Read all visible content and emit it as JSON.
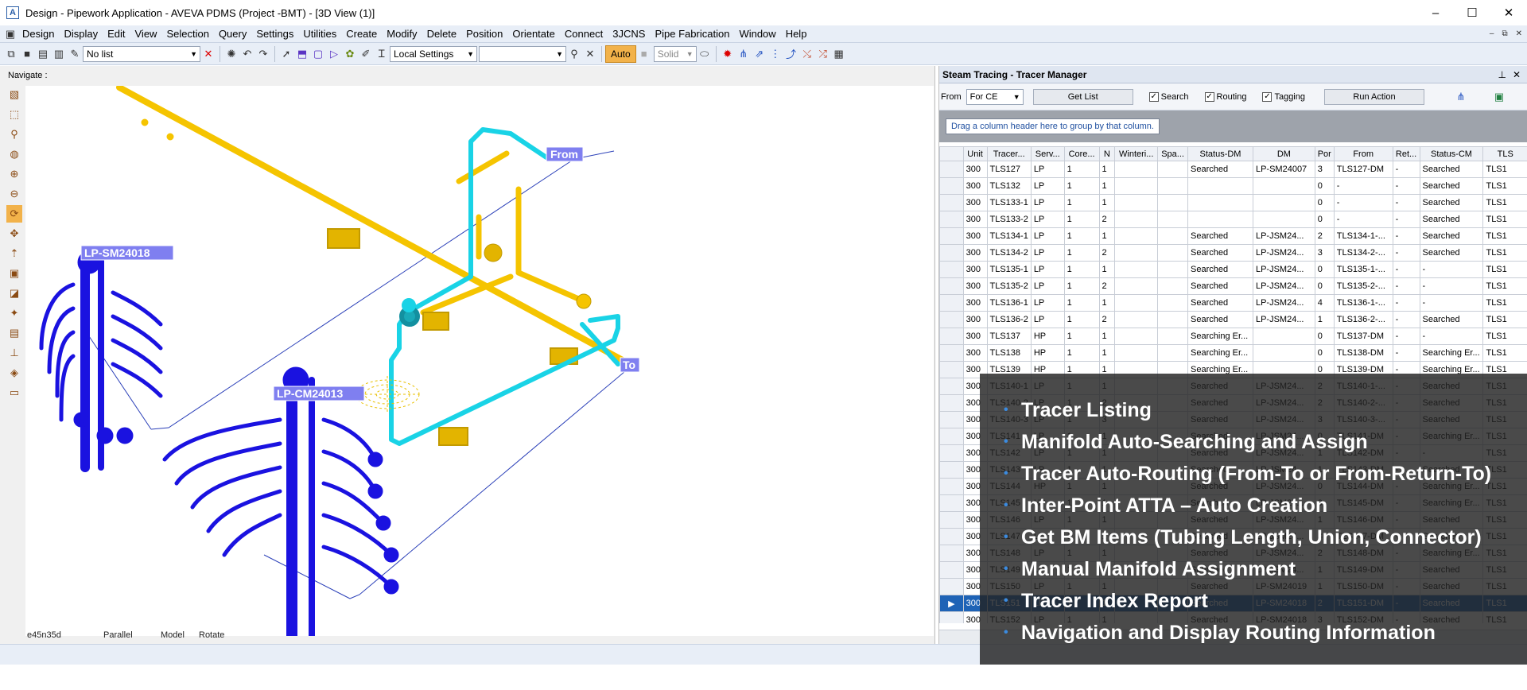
{
  "window": {
    "title": "Design - Pipework Application - AVEVA PDMS (Project -BMT) - [3D View (1)]",
    "app_icon": "A",
    "minimize": "–",
    "maximize": "☐",
    "close": "✕"
  },
  "menubar": {
    "items": [
      "Design",
      "Display",
      "Edit",
      "View",
      "Selection",
      "Query",
      "Settings",
      "Utilities",
      "Create",
      "Modify",
      "Delete",
      "Position",
      "Orientate",
      "Connect",
      "3JCNS",
      "Pipe Fabrication",
      "Window",
      "Help"
    ],
    "mdi_min": "–",
    "mdi_restore": "⧉",
    "mdi_close": "✕"
  },
  "toolbar": {
    "list_value": "No list",
    "settings_value": "Local Settings",
    "empty_combo": "",
    "auto_label": "Auto",
    "solid_label": "Solid"
  },
  "viewport": {
    "navigate_label": "Navigate :",
    "status_coord": "e45n35d",
    "status_projection": "Parallel",
    "status_mode": "Model",
    "status_action": "Rotate",
    "labels": {
      "from": "From",
      "to": "To",
      "manifold1": "LP-SM24018",
      "manifold2": "LP-CM24013"
    }
  },
  "panel": {
    "title": "Steam Tracing - Tracer Manager",
    "pin": "⊥",
    "close": "✕",
    "from_label": "From",
    "from_value": "For CE",
    "get_list": "Get List",
    "search_label": "Search",
    "routing_label": "Routing",
    "tagging_label": "Tagging",
    "run_action": "Run Action",
    "group_hint": "Drag a column header here to group by that column.",
    "columns": [
      "Unit",
      "Tracer...",
      "Serv...",
      "Core...",
      "N",
      "Winteri...",
      "Spa...",
      "Status-DM",
      "DM",
      "Por",
      "From",
      "Ret...",
      "Status-CM",
      "TLS"
    ],
    "rows": [
      [
        "300",
        "TLS127",
        "LP",
        "1",
        "1",
        "",
        "",
        "Searched",
        "LP-SM24007",
        "3",
        "TLS127-DM",
        "-",
        "Searched",
        "TLS1"
      ],
      [
        "300",
        "TLS132",
        "LP",
        "1",
        "1",
        "",
        "",
        "",
        "",
        "0",
        "-",
        "-",
        "Searched",
        "TLS1"
      ],
      [
        "300",
        "TLS133-1",
        "LP",
        "1",
        "1",
        "",
        "",
        "",
        "",
        "0",
        "-",
        "-",
        "Searched",
        "TLS1"
      ],
      [
        "300",
        "TLS133-2",
        "LP",
        "1",
        "2",
        "",
        "",
        "",
        "",
        "0",
        "-",
        "-",
        "Searched",
        "TLS1"
      ],
      [
        "300",
        "TLS134-1",
        "LP",
        "1",
        "1",
        "",
        "",
        "Searched",
        "LP-JSM24...",
        "2",
        "TLS134-1-...",
        "-",
        "Searched",
        "TLS1"
      ],
      [
        "300",
        "TLS134-2",
        "LP",
        "1",
        "2",
        "",
        "",
        "Searched",
        "LP-JSM24...",
        "3",
        "TLS134-2-...",
        "-",
        "Searched",
        "TLS1"
      ],
      [
        "300",
        "TLS135-1",
        "LP",
        "1",
        "1",
        "",
        "",
        "Searched",
        "LP-JSM24...",
        "0",
        "TLS135-1-...",
        "-",
        "-",
        "TLS1"
      ],
      [
        "300",
        "TLS135-2",
        "LP",
        "1",
        "2",
        "",
        "",
        "Searched",
        "LP-JSM24...",
        "0",
        "TLS135-2-...",
        "-",
        "-",
        "TLS1"
      ],
      [
        "300",
        "TLS136-1",
        "LP",
        "1",
        "1",
        "",
        "",
        "Searched",
        "LP-JSM24...",
        "4",
        "TLS136-1-...",
        "-",
        "-",
        "TLS1"
      ],
      [
        "300",
        "TLS136-2",
        "LP",
        "1",
        "2",
        "",
        "",
        "Searched",
        "LP-JSM24...",
        "1",
        "TLS136-2-...",
        "-",
        "Searched",
        "TLS1"
      ],
      [
        "300",
        "TLS137",
        "HP",
        "1",
        "1",
        "",
        "",
        "Searching Er...",
        "",
        "0",
        "TLS137-DM",
        "-",
        "-",
        "TLS1"
      ],
      [
        "300",
        "TLS138",
        "HP",
        "1",
        "1",
        "",
        "",
        "Searching Er...",
        "",
        "0",
        "TLS138-DM",
        "-",
        "Searching Er...",
        "TLS1"
      ],
      [
        "300",
        "TLS139",
        "HP",
        "1",
        "1",
        "",
        "",
        "Searching Er...",
        "",
        "0",
        "TLS139-DM",
        "-",
        "Searching Er...",
        "TLS1"
      ],
      [
        "300",
        "TLS140-1",
        "LP",
        "1",
        "1",
        "",
        "",
        "Searched",
        "LP-JSM24...",
        "2",
        "TLS140-1-...",
        "-",
        "Searched",
        "TLS1"
      ],
      [
        "300",
        "TLS140-2",
        "LP",
        "1",
        "2",
        "",
        "",
        "Searched",
        "LP-JSM24...",
        "2",
        "TLS140-2-...",
        "-",
        "Searched",
        "TLS1"
      ],
      [
        "300",
        "TLS140-3",
        "LP",
        "1",
        "3",
        "",
        "",
        "Searched",
        "LP-JSM24...",
        "3",
        "TLS140-3-...",
        "-",
        "Searched",
        "TLS1"
      ],
      [
        "300",
        "TLS141",
        "LP",
        "1",
        "1",
        "",
        "",
        "Searched",
        "LP-JSM24...",
        "0",
        "TLS141-DM",
        "-",
        "Searching Er...",
        "TLS1"
      ],
      [
        "300",
        "TLS142",
        "LP",
        "1",
        "1",
        "",
        "",
        "Searched",
        "LP-JSM24...",
        "1",
        "TLS142-DM",
        "-",
        "-",
        "TLS1"
      ],
      [
        "300",
        "TLS143",
        "LP",
        "1",
        "1",
        "",
        "",
        "Searched",
        "LP-JSM24...",
        "1",
        "TLS143-DM",
        "-",
        "Searched",
        "TLS1"
      ],
      [
        "300",
        "TLS144",
        "HP",
        "1",
        "1",
        "",
        "",
        "Searched",
        "LP-JSM24...",
        "0",
        "TLS144-DM",
        "-",
        "Searching Er...",
        "TLS1"
      ],
      [
        "300",
        "TLS145",
        "HP",
        "1",
        "1",
        "",
        "",
        "Searched",
        "LP-JSM24...",
        "0",
        "TLS145-DM",
        "-",
        "Searching Er...",
        "TLS1"
      ],
      [
        "300",
        "TLS146",
        "LP",
        "1",
        "1",
        "",
        "",
        "Searched",
        "LP-JSM24...",
        "1",
        "TLS146-DM",
        "-",
        "Searched",
        "TLS1"
      ],
      [
        "300",
        "TLS147",
        "LP",
        "1",
        "1",
        "",
        "",
        "Searched",
        "LP-JSM24...",
        "3",
        "TLS147-DM",
        "-",
        "Searched",
        "TLS1"
      ],
      [
        "300",
        "TLS148",
        "LP",
        "1",
        "1",
        "",
        "",
        "Searched",
        "LP-JSM24...",
        "2",
        "TLS148-DM",
        "-",
        "Searching Er...",
        "TLS1"
      ],
      [
        "300",
        "TLS149",
        "LP",
        "1",
        "1",
        "",
        "",
        "Searched",
        "LP-JSM24...",
        "1",
        "TLS149-DM",
        "-",
        "Searched",
        "TLS1"
      ],
      [
        "300",
        "TLS150",
        "LP",
        "1",
        "1",
        "",
        "",
        "Searched",
        "LP-SM24019",
        "1",
        "TLS150-DM",
        "-",
        "Searched",
        "TLS1"
      ],
      [
        "300",
        "TLS151",
        "LP",
        "1",
        "1",
        "",
        "",
        "Searched",
        "LP-SM24018",
        "2",
        "TLS151-DM",
        "-",
        "Searched",
        "TLS1"
      ],
      [
        "300",
        "TLS152",
        "LP",
        "1",
        "1",
        "",
        "",
        "Searched",
        "LP-SM24018",
        "3",
        "TLS152-DM",
        "-",
        "Searched",
        "TLS1"
      ]
    ],
    "selected_row": 26
  },
  "features": [
    "Tracer Listing",
    "Manifold Auto-Searching and Assign",
    "Tracer Auto-Routing (From-To or From-Return-To)",
    "Inter-Point ATTA – Auto Creation",
    "Get BM Items (Tubing Length, Union, Connector)",
    "Manual Manifold Assignment",
    "Tracer Index Report",
    "Navigation and Display Routing Information"
  ],
  "colors": {
    "pipe_yellow": "#f5c400",
    "tracer_cyan": "#19d3e6",
    "manifold_blue": "#1a12e0",
    "selection": "#1e63b6",
    "label_bg": "#7f7ff0"
  }
}
